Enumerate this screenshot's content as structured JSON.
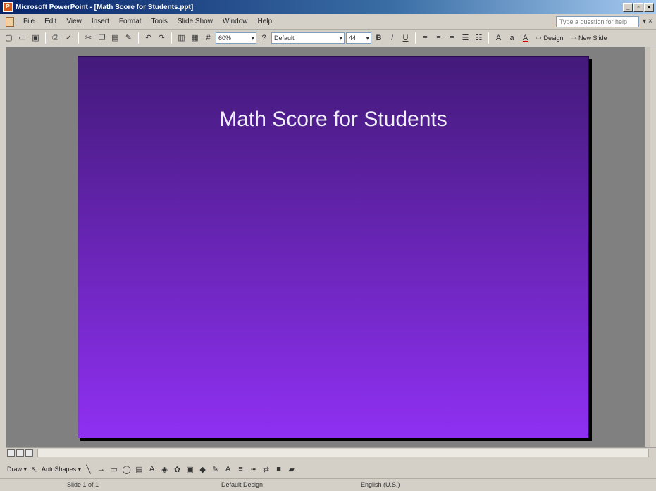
{
  "window": {
    "title": "Microsoft PowerPoint - [Math Score for Students.ppt]",
    "app_icon_text": "P",
    "buttons": [
      "_",
      "▫",
      "×"
    ]
  },
  "menu": {
    "items": [
      "File",
      "Edit",
      "View",
      "Insert",
      "Format",
      "Tools",
      "Slide Show",
      "Window",
      "Help"
    ],
    "help_placeholder": "Type a question for help",
    "close_label": "▾ ×"
  },
  "toolbar": {
    "zoom": "60%",
    "font_name": "Default",
    "font_size": "44",
    "bold": "B",
    "italic": "I",
    "underline": "U",
    "font_color_icon": "A",
    "design_label": "Design",
    "new_slide_label": "New Slide"
  },
  "slide": {
    "title": "Math Score for Students",
    "background_top": "#431a7a",
    "background_bottom": "#8f30f2"
  },
  "drawbar": {
    "draw_label": "Draw ▾",
    "autoshapes_label": "AutoShapes ▾"
  },
  "status": {
    "slide_info": "Slide 1 of 1",
    "design": "Default Design",
    "language": "English (U.S.)"
  }
}
